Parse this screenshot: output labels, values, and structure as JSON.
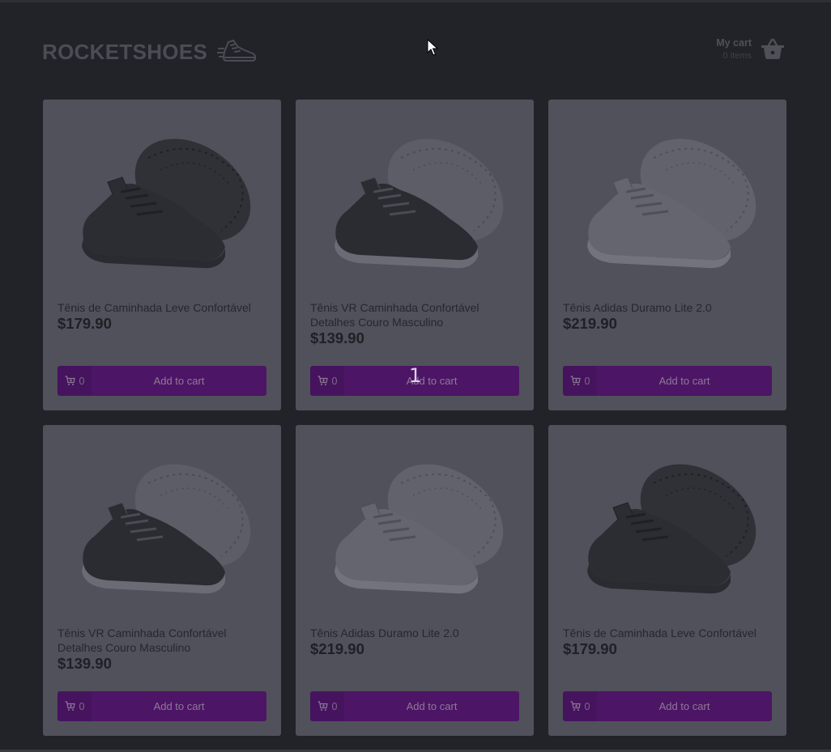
{
  "header": {
    "logo_text": "ROCKETSHOES",
    "logo_icon": "running-shoe-icon",
    "cart_title": "My cart",
    "cart_count": "0 items",
    "cart_icon": "shopping-basket-icon"
  },
  "products": [
    {
      "name": "Tênis de Caminhada Leve Confortável",
      "price": "$179.90",
      "count": "0",
      "button": "Add to cart",
      "shoe": "black"
    },
    {
      "name": "Tênis VR Caminhada Confortável Detalhes Couro Masculino",
      "price": "$139.90",
      "count": "0",
      "button": "Add to cart",
      "shoe": "black-white"
    },
    {
      "name": "Tênis Adidas Duramo Lite 2.0",
      "price": "$219.90",
      "count": "0",
      "button": "Add to cart",
      "shoe": "white"
    },
    {
      "name": "Tênis VR Caminhada Confortável Detalhes Couro Masculino",
      "price": "$139.90",
      "count": "0",
      "button": "Add to cart",
      "shoe": "black-white"
    },
    {
      "name": "Tênis Adidas Duramo Lite 2.0",
      "price": "$219.90",
      "count": "0",
      "button": "Add to cart",
      "shoe": "white"
    },
    {
      "name": "Tênis de Caminhada Leve Confortável",
      "price": "$179.90",
      "count": "0",
      "button": "Add to cart",
      "shoe": "black"
    }
  ],
  "overlay_number": "1",
  "colors": {
    "background": "#222329",
    "card": "#50515a",
    "button": "#4d1566"
  }
}
